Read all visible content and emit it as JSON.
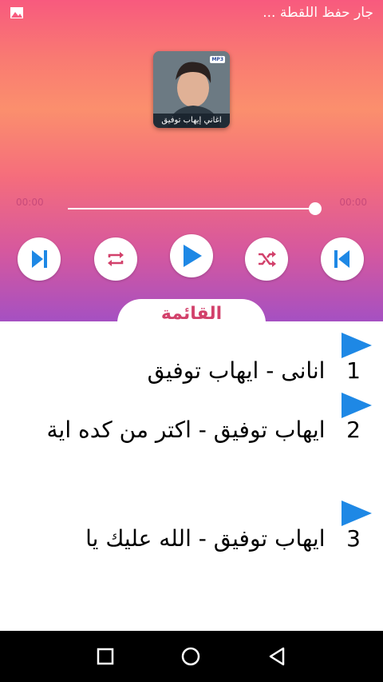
{
  "status_bar": {
    "text": "جار حفظ اللقطة ...",
    "icon": "image-icon"
  },
  "cover": {
    "caption": "اغاني إيهاب توفيق",
    "badge": "MP3"
  },
  "player": {
    "time_elapsed": "00:00",
    "time_total": "00:00",
    "progress": 1.0,
    "controls": [
      "skip-next-icon",
      "repeat-icon",
      "play-icon",
      "shuffle-icon",
      "skip-previous-icon"
    ],
    "accent_color": "#1e88e5"
  },
  "tab": {
    "label": "القائمة"
  },
  "songs": [
    {
      "number": "1",
      "title": "انانى - ايهاب توفيق"
    },
    {
      "number": "2",
      "title": "ايهاب توفيق - اكتر من كده اية"
    },
    {
      "number": "3",
      "title": "ايهاب توفيق - الله عليك يا"
    }
  ],
  "nav_bar": {
    "icons": [
      "square-recent-icon",
      "circle-home-icon",
      "triangle-back-icon"
    ]
  }
}
